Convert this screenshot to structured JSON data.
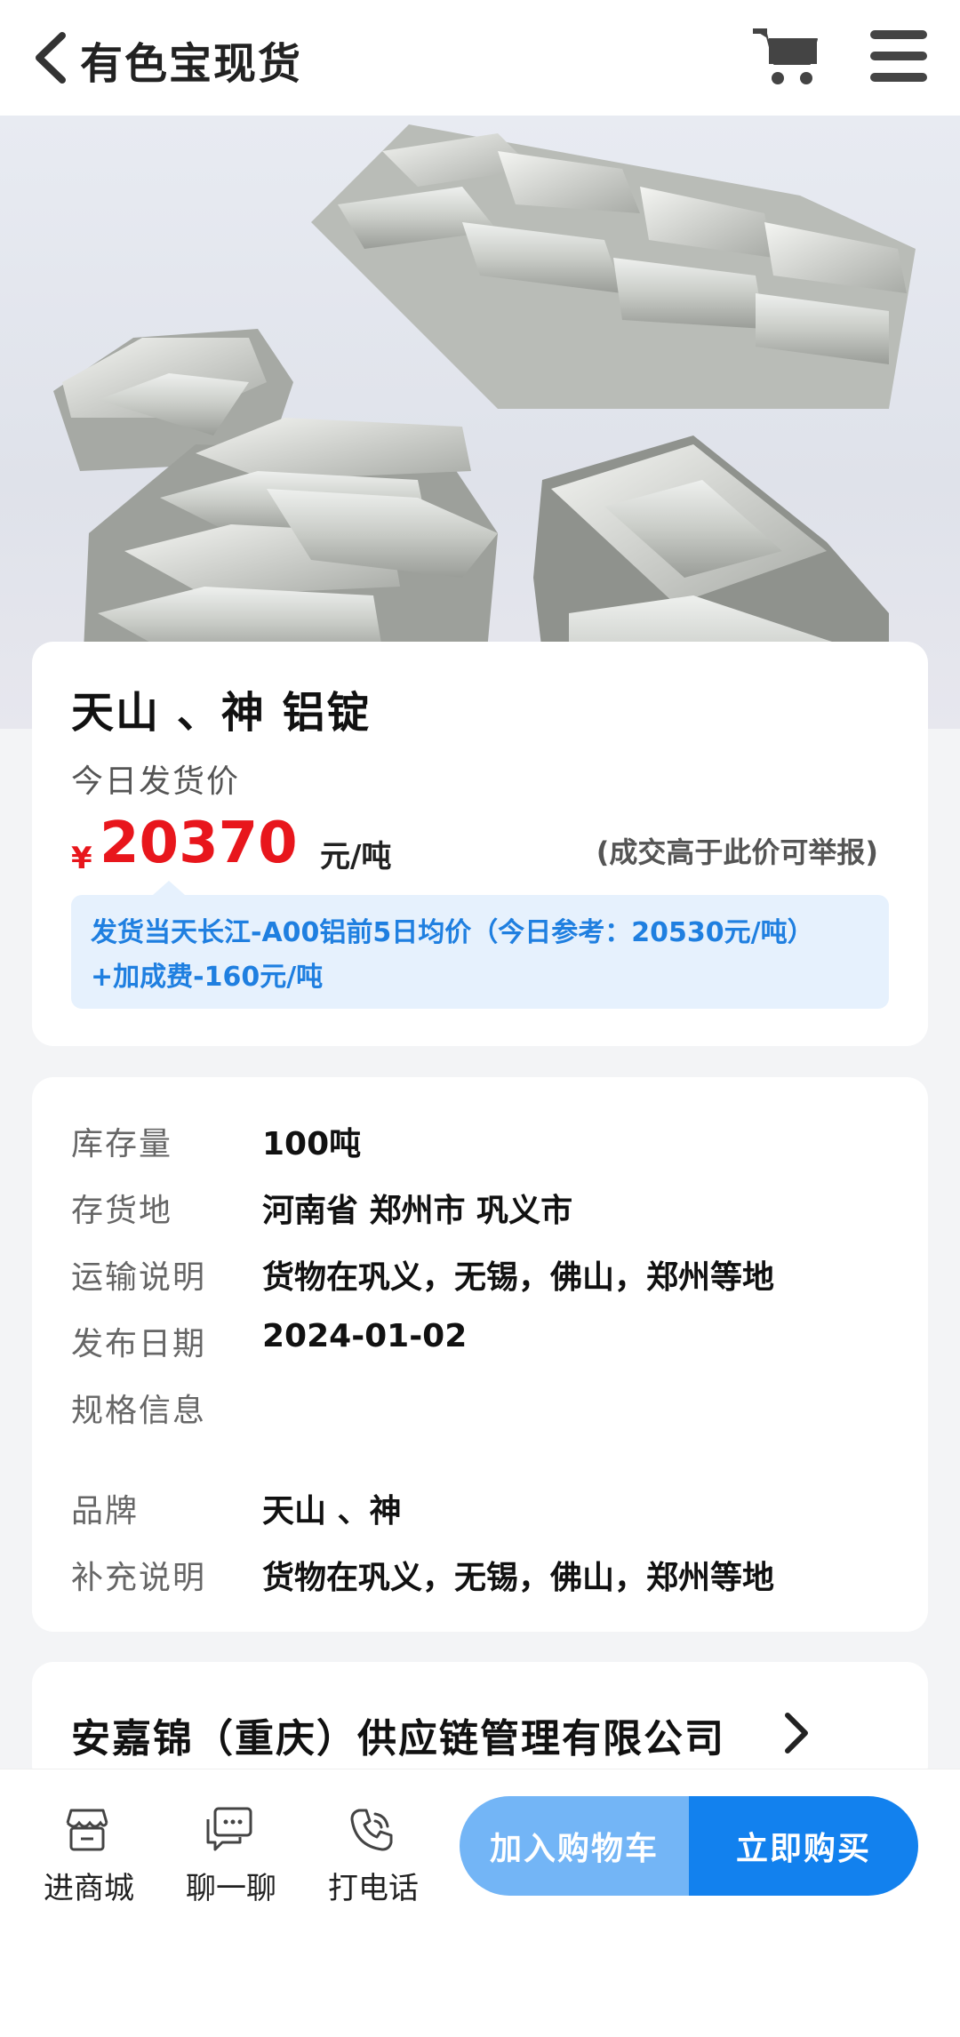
{
  "header": {
    "title": "有色宝现货",
    "back_icon": "chevron-left-icon",
    "cart_icon": "shopping-cart-icon",
    "menu_icon": "hamburger-menu-icon"
  },
  "hero": {
    "description_icon": "aluminum-ingots-image"
  },
  "product": {
    "title": "天山 、神 铝锭",
    "price_caption": "今日发货价",
    "currency": "¥",
    "price": "20370",
    "unit": "元/吨",
    "report_note": "(成交高于此价可举报)",
    "formula_line1": "发货当天长江-A00铝前5日均价（今日参考：20530元/吨）",
    "formula_line2": "+加成费-160元/吨"
  },
  "specs": [
    {
      "label": "库存量",
      "value": "100吨"
    },
    {
      "label": "存货地",
      "value": "河南省 郑州市 巩义市"
    },
    {
      "label": "运输说明",
      "value": "货物在巩义，无锡，佛山，郑州等地"
    },
    {
      "label": "发布日期",
      "value": "2024-01-02"
    },
    {
      "label": "规格信息",
      "value": ""
    },
    {
      "label": "品牌",
      "value": "天山 、神"
    },
    {
      "label": "补充说明",
      "value": "货物在巩义，无锡，佛山，郑州等地"
    }
  ],
  "seller": {
    "name": "安嘉锦（重庆）供应链管理有限公司"
  },
  "bottom_bar": {
    "nav": [
      {
        "label": "进商城",
        "icon": "store-icon"
      },
      {
        "label": "聊一聊",
        "icon": "chat-icon"
      },
      {
        "label": "打电话",
        "icon": "phone-icon"
      }
    ],
    "add_to_cart": "加入购物车",
    "buy_now": "立即购买"
  },
  "colors": {
    "price_red": "#e8161c",
    "accent_blue": "#1281ee",
    "light_blue": "#73b5f6",
    "formula_bg": "#e6f1fd"
  }
}
